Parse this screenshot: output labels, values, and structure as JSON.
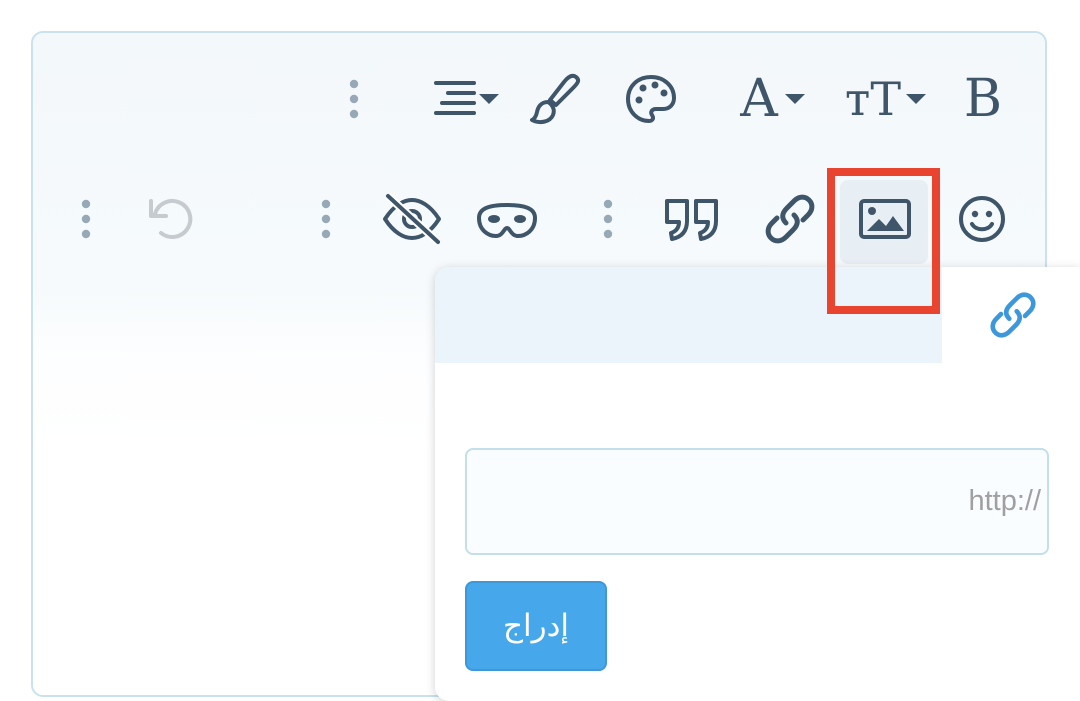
{
  "toolbar": {
    "row1": {
      "bold_label": "B",
      "font_size_label": "тT",
      "font_color_label": "A"
    }
  },
  "image_popup": {
    "url_placeholder": "http://",
    "insert_label": "إدراج"
  },
  "colors": {
    "icon": "#3f566a",
    "highlight": "#e8442f",
    "accent": "#47a7eb",
    "link_active": "#3d98db"
  }
}
